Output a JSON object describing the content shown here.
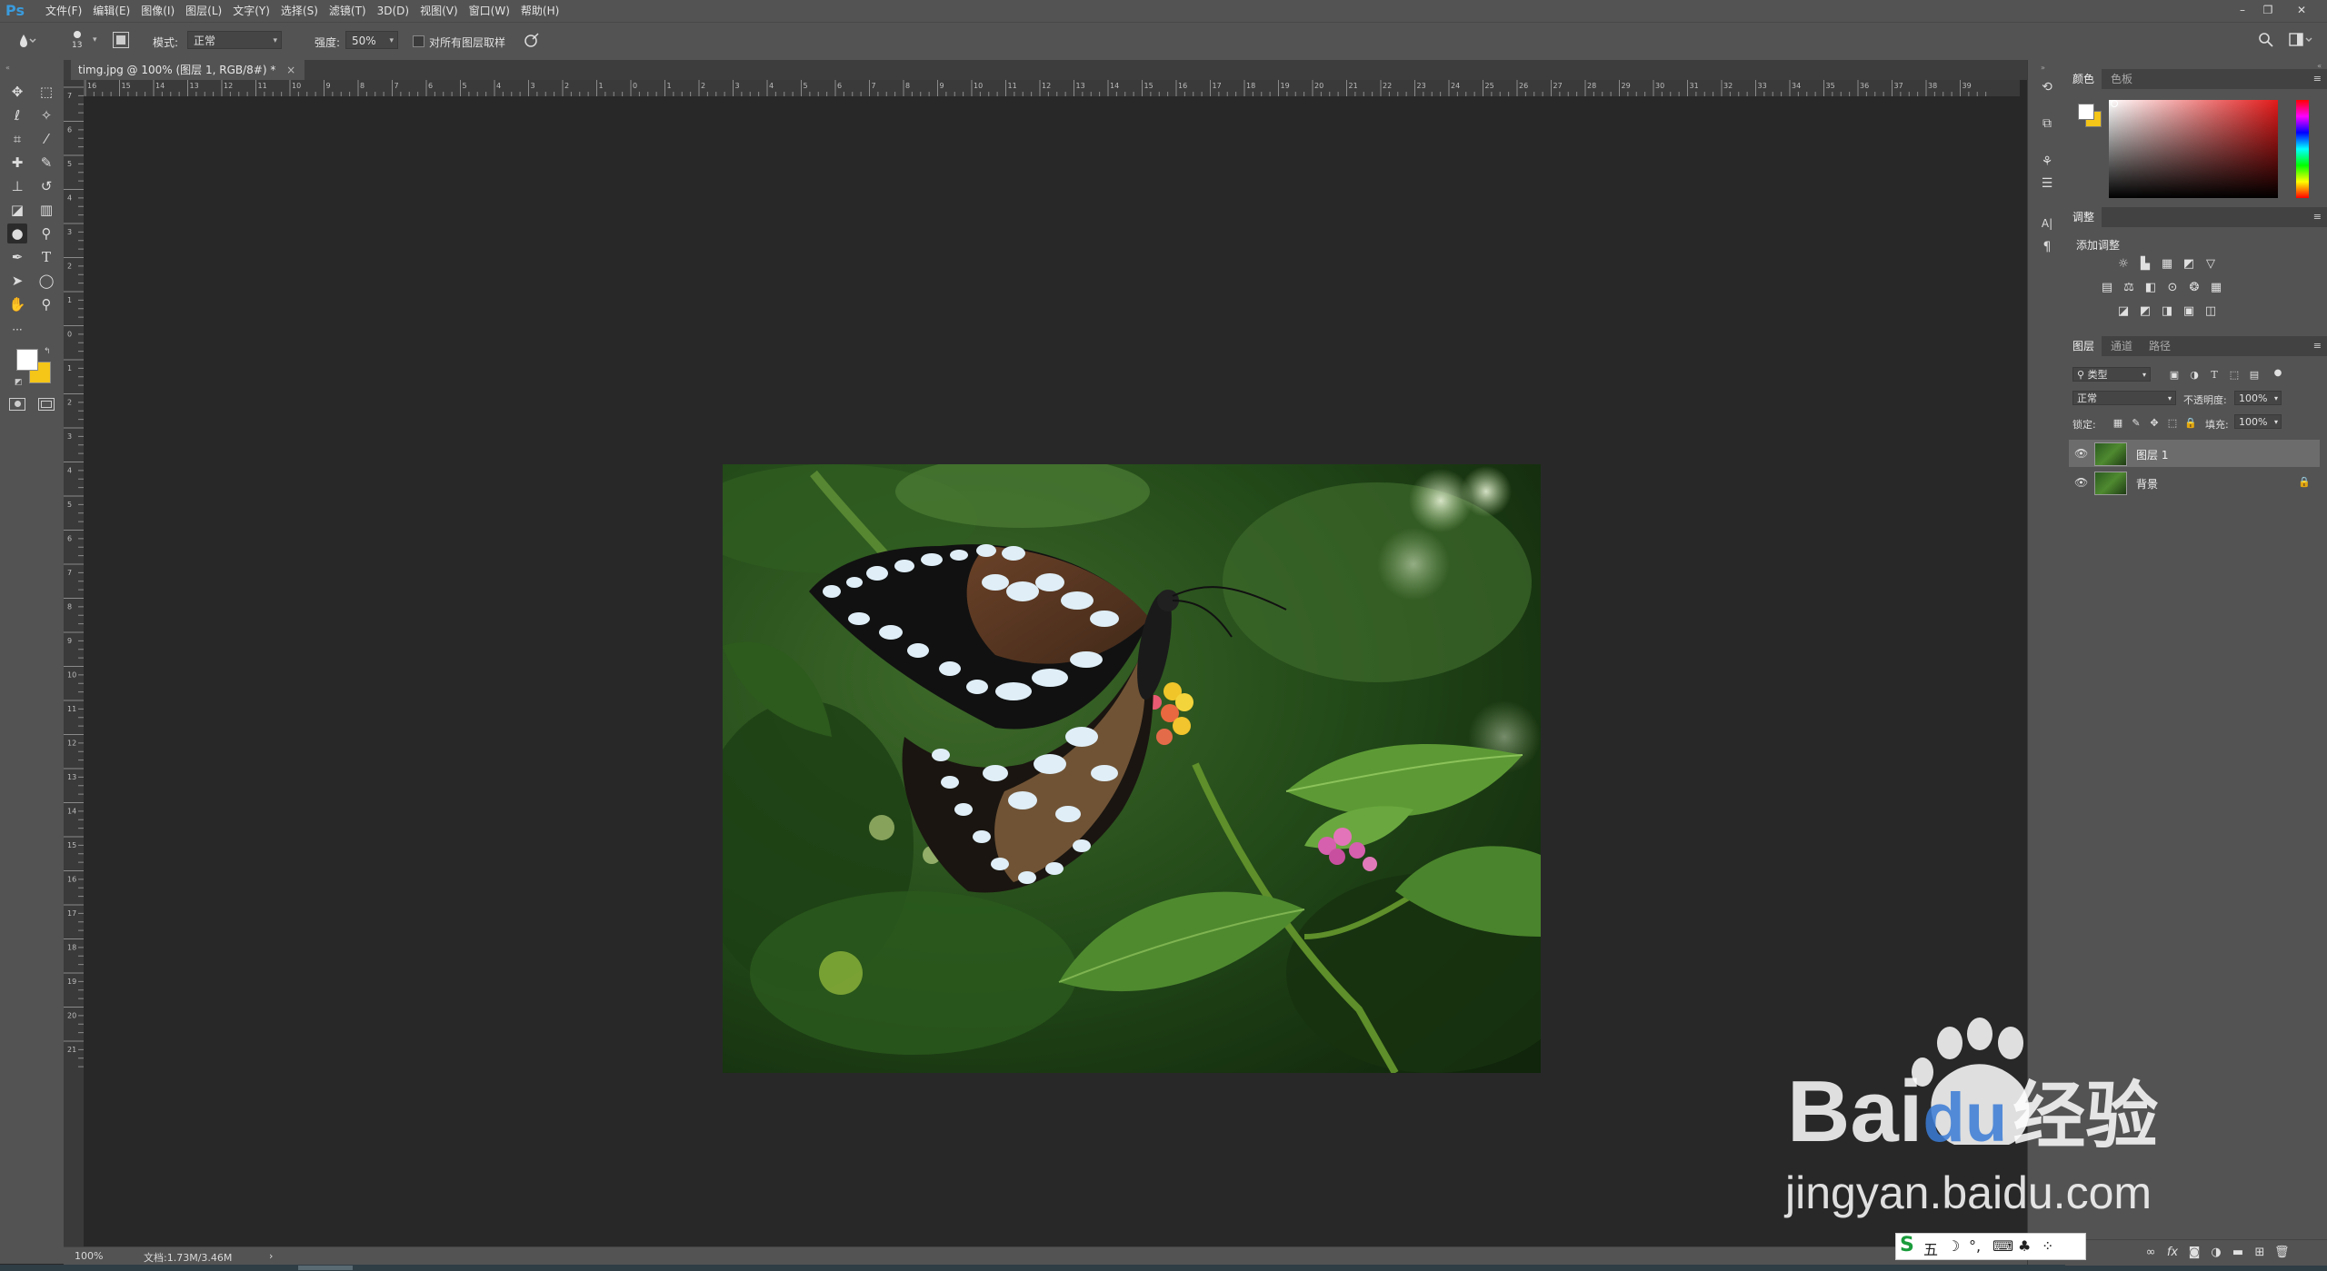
{
  "app": {
    "logo": "Ps",
    "menu": [
      "文件(F)",
      "编辑(E)",
      "图像(I)",
      "图层(L)",
      "文字(Y)",
      "选择(S)",
      "滤镜(T)",
      "3D(D)",
      "视图(V)",
      "窗口(W)",
      "帮助(H)"
    ],
    "window_controls": [
      "–",
      "❐",
      "✕"
    ]
  },
  "options": {
    "brush_size": "13",
    "mode_label": "模式:",
    "mode_value": "正常",
    "strength_label": "强度:",
    "strength_value": "50%",
    "sample_all_label": "对所有图层取样"
  },
  "document": {
    "tab_title": "timg.jpg @ 100% (图层 1, RGB/8#) *",
    "tab_close": "×",
    "zoom": "100%",
    "doc_info": "文档:1.73M/3.46M",
    "status_arrow": "›"
  },
  "rulers": {
    "horizontal": [
      "16",
      "15",
      "14",
      "13",
      "12",
      "11",
      "10",
      "9",
      "8",
      "7",
      "6",
      "5",
      "4",
      "3",
      "2",
      "1",
      "0",
      "1",
      "2",
      "3",
      "4",
      "5",
      "6",
      "7",
      "8",
      "9",
      "10",
      "11",
      "12",
      "13",
      "14",
      "15",
      "16",
      "17",
      "18",
      "19",
      "20",
      "21",
      "22",
      "23",
      "24",
      "25",
      "26",
      "27",
      "28",
      "29",
      "30",
      "31",
      "32",
      "33",
      "34",
      "35",
      "36",
      "37",
      "38",
      "39"
    ],
    "vertical": [
      "7",
      "6",
      "5",
      "4",
      "3",
      "2",
      "1",
      "0",
      "1",
      "2",
      "3",
      "4",
      "5",
      "6",
      "7",
      "8",
      "9",
      "10",
      "11",
      "12",
      "13",
      "14",
      "15",
      "16",
      "17",
      "18",
      "19",
      "20",
      "21"
    ]
  },
  "panels": {
    "color": {
      "tabs": [
        "颜色",
        "色板"
      ]
    },
    "adjustments": {
      "title": "调整",
      "add_label": "添加调整"
    },
    "layers": {
      "tabs": [
        "图层",
        "通道",
        "路径"
      ],
      "filter_kind": "类型",
      "blend_mode": "正常",
      "opacity_label": "不透明度:",
      "opacity_value": "100%",
      "lock_label": "锁定:",
      "fill_label": "填充:",
      "fill_value": "100%",
      "items": [
        {
          "name": "图层 1",
          "selected": true,
          "locked": false
        },
        {
          "name": "背景",
          "selected": false,
          "locked": true
        }
      ],
      "footer_icons": [
        "link-icon",
        "fx-icon",
        "mask-icon",
        "adjustment-icon",
        "group-icon",
        "new-layer-icon",
        "trash-icon"
      ],
      "fx_label": "fx"
    }
  },
  "watermark": {
    "brand": "Bai",
    "brand_du": "du",
    "brand_cn": "经验",
    "url": "jingyan.baidu.com"
  },
  "ime": {
    "items": [
      "S",
      "五",
      "☽",
      "°,",
      "⌨",
      "♣",
      "⁘"
    ]
  },
  "colors": {
    "ui_bg": "#535353",
    "canvas_bg": "#282828",
    "accent_ps": "#3a9bdc",
    "foreground_swatch": "#ffffff",
    "background_swatch": "#f5c518"
  }
}
